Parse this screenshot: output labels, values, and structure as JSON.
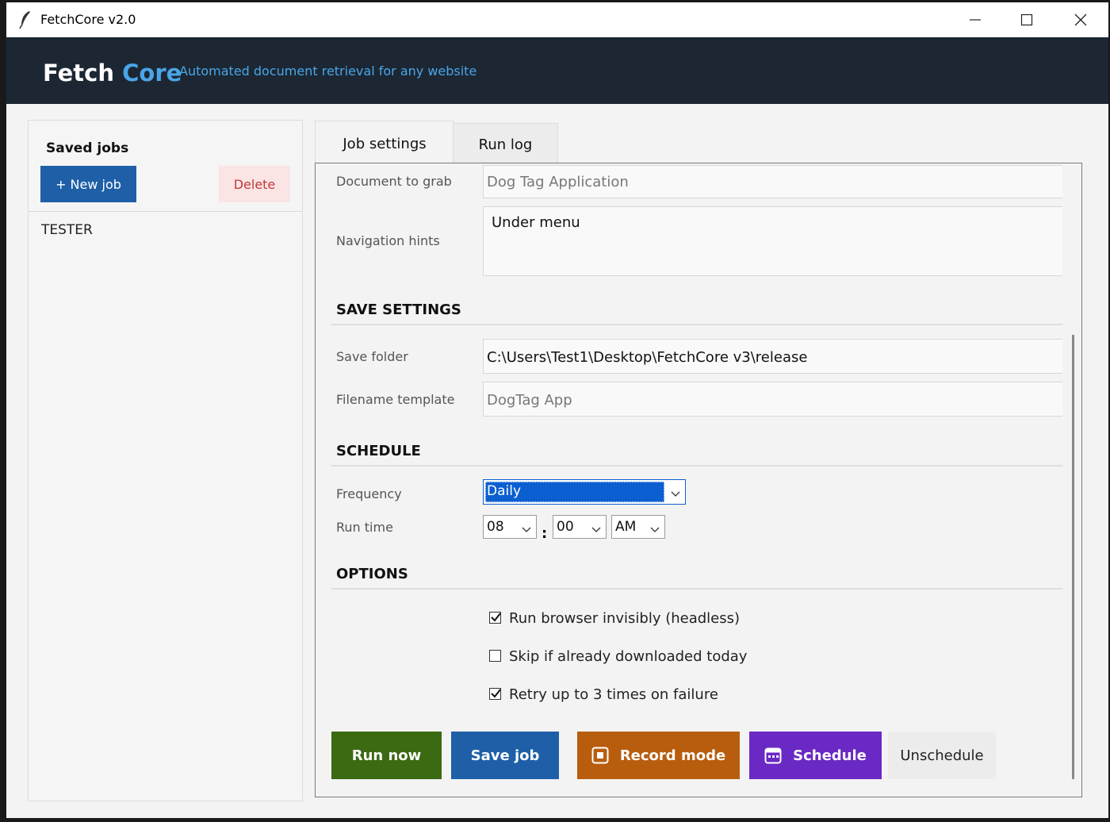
{
  "window": {
    "title": "FetchCore v2.0"
  },
  "header": {
    "brand_part1": "Fetch",
    "brand_part2": "Core",
    "tagline": "Automated document retrieval for any website"
  },
  "sidebar": {
    "heading": "Saved jobs",
    "new_button": "+ New job",
    "delete_button": "Delete",
    "jobs": [
      "TESTER"
    ]
  },
  "tabs": [
    "Job settings",
    "Run log"
  ],
  "form": {
    "document_label": "Document to grab",
    "document_value": "Dog Tag Application",
    "hints_label": "Navigation hints",
    "hints_value": "Under menu",
    "save_section": "SAVE SETTINGS",
    "folder_label": "Save folder",
    "folder_value": "C:\\Users\\Test1\\Desktop\\FetchCore v3\\release",
    "filename_label": "Filename template",
    "filename_value": "DogTag App",
    "schedule_section": "SCHEDULE",
    "frequency_label": "Frequency",
    "frequency_value": "Daily",
    "runtime_label": "Run time",
    "hour": "08",
    "minute": "00",
    "ampm": "AM",
    "colon": ":",
    "options_section": "OPTIONS",
    "options": [
      {
        "label": "Run browser invisibly (headless)",
        "checked": true
      },
      {
        "label": "Skip if already downloaded today",
        "checked": false
      },
      {
        "label": "Retry up to 3 times on failure",
        "checked": true
      }
    ]
  },
  "actions": {
    "run": "Run now",
    "save": "Save job",
    "record": "Record mode",
    "schedule": "Schedule",
    "unschedule": "Unschedule"
  },
  "colors": {
    "header_bg": "#1c2733",
    "accent": "#4aa5e6",
    "run": "#3b6a12",
    "save": "#1f5fa8",
    "record": "#b85d0e",
    "schedule": "#6a28c4"
  }
}
